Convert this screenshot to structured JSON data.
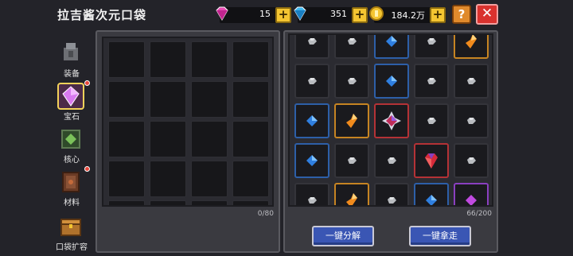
{
  "header": {
    "title": "拉吉酱次元口袋",
    "currencies": [
      {
        "name": "pink-gem",
        "value": "15"
      },
      {
        "name": "blue-gem",
        "value": "351"
      },
      {
        "name": "gold-coin",
        "value": "184.2万"
      }
    ],
    "plus_label": "+",
    "help_label": "?",
    "close_label": "✕"
  },
  "nav": {
    "items": [
      {
        "label": "装备",
        "icon": "equipment-icon",
        "badge": false
      },
      {
        "label": "宝石",
        "icon": "gem-icon",
        "badge": true,
        "active": true
      },
      {
        "label": "核心",
        "icon": "core-icon",
        "badge": false
      },
      {
        "label": "材料",
        "icon": "material-icon",
        "badge": true
      },
      {
        "label": "口袋扩容",
        "icon": "pocket-expand-icon",
        "badge": false
      }
    ]
  },
  "left_panel": {
    "count": "0/80",
    "columns": 4,
    "visible_rows": 5
  },
  "right_panel": {
    "count": "66/200",
    "rows": [
      [
        "stone",
        "stone",
        "blue-gem",
        "stone",
        "orange-gem"
      ],
      [
        "stone",
        "stone",
        "blue-gem",
        "stone",
        "stone"
      ],
      [
        "blue-gem",
        "orange-gem",
        "red-purple-gem",
        "stone",
        "stone"
      ],
      [
        "blue-gem",
        "stone",
        "stone",
        "red-gem",
        "stone"
      ],
      [
        "stone",
        "orange-gem",
        "stone",
        "blue-gem",
        "purple-gem"
      ]
    ],
    "buttons": {
      "decompose": "一键分解",
      "take_all": "一键拿走"
    }
  },
  "colors": {
    "blue": "#2d5fa8",
    "orange": "#c68422",
    "red": "#b43236",
    "purple": "#8a3fc0",
    "button": "#3a56b4"
  }
}
